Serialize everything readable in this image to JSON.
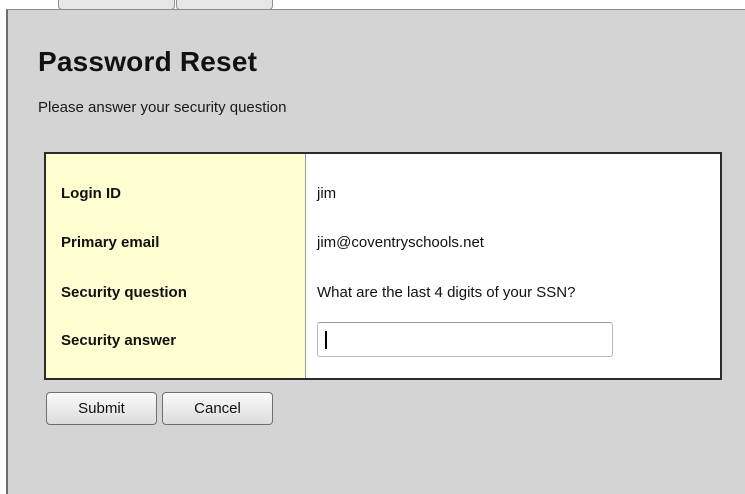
{
  "page": {
    "title": "Password Reset",
    "subtitle": "Please answer your security question"
  },
  "form": {
    "rows": [
      {
        "label": "Login ID",
        "value": "jim"
      },
      {
        "label": "Primary email",
        "value": "jim@coventryschools.net"
      },
      {
        "label": "Security question",
        "value": "What are the last 4 digits of your SSN?"
      },
      {
        "label": "Security answer",
        "value": ""
      }
    ],
    "answer_placeholder": ""
  },
  "buttons": {
    "submit_label": "Submit",
    "cancel_label": "Cancel"
  },
  "colors": {
    "panel_background": "#d4d4d4",
    "label_column_background": "#fefed0",
    "form_background": "#ffffff"
  }
}
